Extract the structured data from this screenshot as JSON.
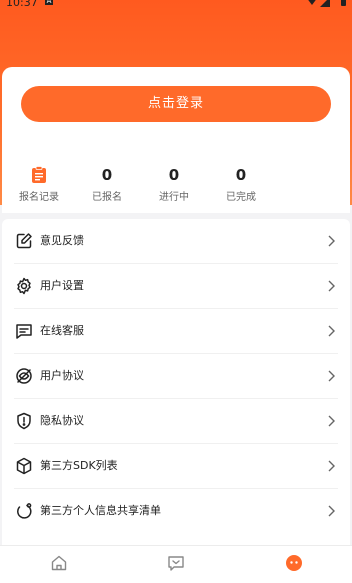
{
  "status_bar": {
    "time": "10:37",
    "notification_badge": "A"
  },
  "login": {
    "button_label": "点击登录"
  },
  "stats": [
    {
      "label": "报名记录",
      "icon": "clipboard-icon"
    },
    {
      "value": "0",
      "label": "已报名"
    },
    {
      "value": "0",
      "label": "进行中"
    },
    {
      "value": "0",
      "label": "已完成"
    }
  ],
  "menu": {
    "items": [
      {
        "label": "意见反馈",
        "icon": "edit-icon"
      },
      {
        "label": "用户设置",
        "icon": "gear-icon"
      },
      {
        "label": "在线客服",
        "icon": "chat-icon"
      },
      {
        "label": "用户协议",
        "icon": "eye-off-icon"
      },
      {
        "label": "隐私协议",
        "icon": "shield-alert-icon"
      },
      {
        "label": "第三方SDK列表",
        "icon": "cube-icon"
      },
      {
        "label": "第三方个人信息共享清单",
        "icon": "share-icon"
      }
    ]
  },
  "tabbar": {
    "tabs": [
      {
        "icon": "home-icon"
      },
      {
        "icon": "message-icon"
      },
      {
        "icon": "profile-icon"
      }
    ]
  },
  "colors": {
    "accent": "#ff6a2a",
    "header": "#ff5a1f"
  }
}
